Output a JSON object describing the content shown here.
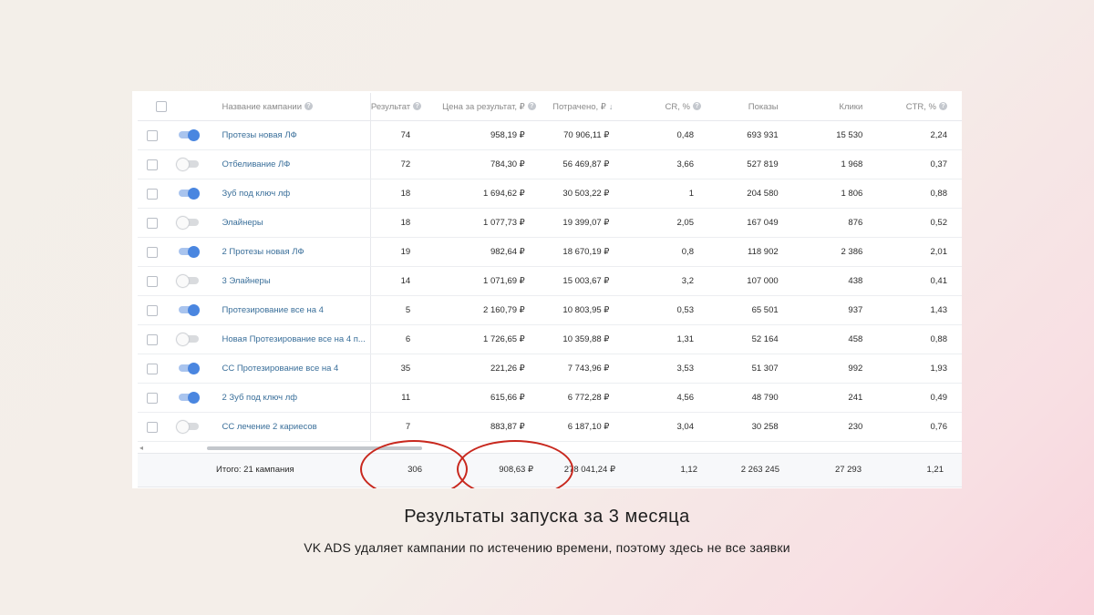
{
  "table": {
    "headers": {
      "name": "Название кампании",
      "result": "Результат",
      "price": "Цена за результат, ₽",
      "spent": "Потрачено, ₽",
      "sort_arrow": "↓",
      "cr": "CR, %",
      "impressions": "Показы",
      "clicks": "Клики",
      "ctr": "CTR, %"
    },
    "help_glyph": "?",
    "rows": [
      {
        "enabled": true,
        "name": "Протезы новая ЛФ",
        "result": "74",
        "price": "958,19 ₽",
        "spent": "70 906,11 ₽",
        "cr": "0,48",
        "impressions": "693 931",
        "clicks": "15 530",
        "ctr": "2,24"
      },
      {
        "enabled": false,
        "name": "Отбеливание ЛФ",
        "result": "72",
        "price": "784,30 ₽",
        "spent": "56 469,87 ₽",
        "cr": "3,66",
        "impressions": "527 819",
        "clicks": "1 968",
        "ctr": "0,37"
      },
      {
        "enabled": true,
        "name": "Зуб под ключ лф",
        "result": "18",
        "price": "1 694,62 ₽",
        "spent": "30 503,22 ₽",
        "cr": "1",
        "impressions": "204 580",
        "clicks": "1 806",
        "ctr": "0,88"
      },
      {
        "enabled": false,
        "name": "Элайнеры",
        "result": "18",
        "price": "1 077,73 ₽",
        "spent": "19 399,07 ₽",
        "cr": "2,05",
        "impressions": "167 049",
        "clicks": "876",
        "ctr": "0,52"
      },
      {
        "enabled": true,
        "name": "2 Протезы новая ЛФ",
        "result": "19",
        "price": "982,64 ₽",
        "spent": "18 670,19 ₽",
        "cr": "0,8",
        "impressions": "118 902",
        "clicks": "2 386",
        "ctr": "2,01"
      },
      {
        "enabled": false,
        "name": "3 Элайнеры",
        "result": "14",
        "price": "1 071,69 ₽",
        "spent": "15 003,67 ₽",
        "cr": "3,2",
        "impressions": "107 000",
        "clicks": "438",
        "ctr": "0,41"
      },
      {
        "enabled": true,
        "name": "Протезирование все на 4",
        "result": "5",
        "price": "2 160,79 ₽",
        "spent": "10 803,95 ₽",
        "cr": "0,53",
        "impressions": "65 501",
        "clicks": "937",
        "ctr": "1,43"
      },
      {
        "enabled": false,
        "name": "Новая Протезирование все на 4 п...",
        "result": "6",
        "price": "1 726,65 ₽",
        "spent": "10 359,88 ₽",
        "cr": "1,31",
        "impressions": "52 164",
        "clicks": "458",
        "ctr": "0,88"
      },
      {
        "enabled": true,
        "name": "СС Протезирование все на 4",
        "result": "35",
        "price": "221,26 ₽",
        "spent": "7 743,96 ₽",
        "cr": "3,53",
        "impressions": "51 307",
        "clicks": "992",
        "ctr": "1,93"
      },
      {
        "enabled": true,
        "name": "2 Зуб под ключ лф",
        "result": "11",
        "price": "615,66 ₽",
        "spent": "6 772,28 ₽",
        "cr": "4,56",
        "impressions": "48 790",
        "clicks": "241",
        "ctr": "0,49"
      },
      {
        "enabled": false,
        "name": "СС лечение 2 кариесов",
        "result": "7",
        "price": "883,87 ₽",
        "spent": "6 187,10 ₽",
        "cr": "3,04",
        "impressions": "30 258",
        "clicks": "230",
        "ctr": "0,76"
      }
    ],
    "totals": {
      "label": "Итого: 21 кампания",
      "result": "306",
      "price": "908,63 ₽",
      "spent": "278 041,24 ₽",
      "cr": "1,12",
      "impressions": "2 263 245",
      "clicks": "27 293",
      "ctr": "1,21"
    },
    "scroll_left_glyph": "◂"
  },
  "caption": {
    "title": "Результаты запуска за 3 месяца",
    "subtitle": "VK ADS удаляет кампании по истечению времени, поэтому здесь не все заявки"
  },
  "colors": {
    "link": "#3a6f9a",
    "toggle_on": "#4a86e0",
    "highlight_ring": "#c8281e"
  }
}
